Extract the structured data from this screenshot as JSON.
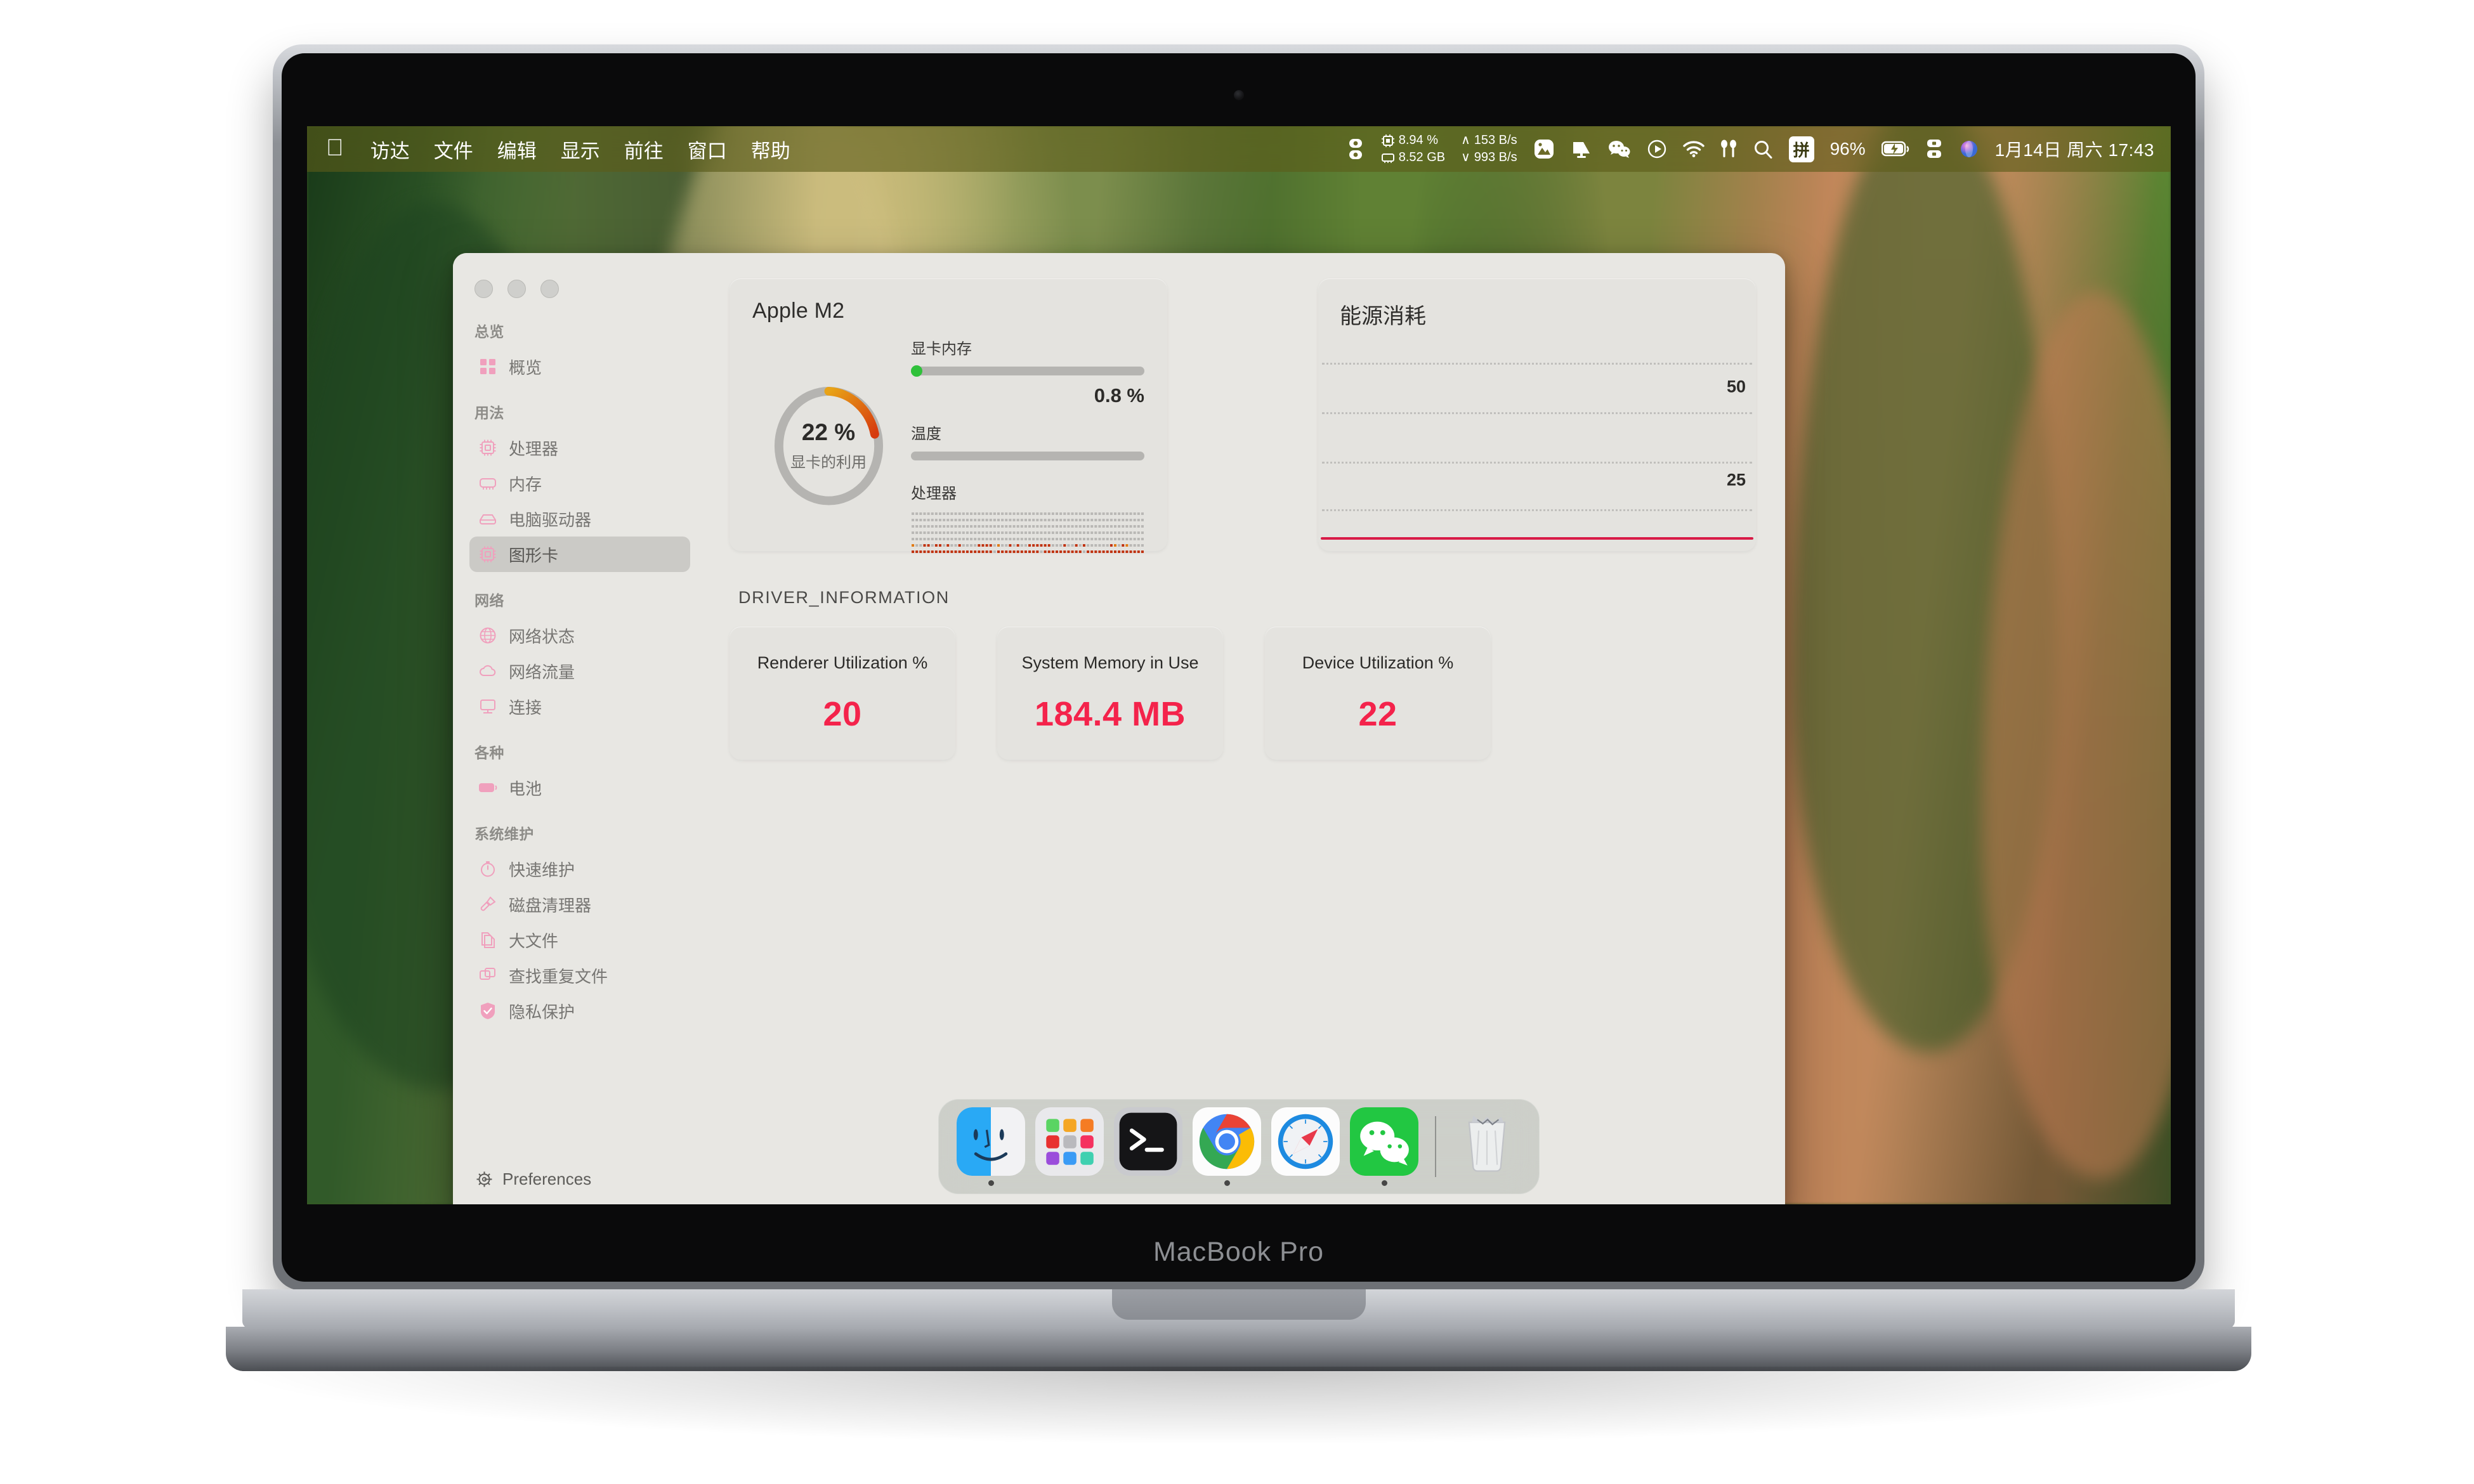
{
  "device": {
    "label": "MacBook Pro"
  },
  "menubar": {
    "apple_icon": "apple-logo",
    "items": [
      "访达",
      "文件",
      "编辑",
      "显示",
      "前往",
      "窗口",
      "帮助"
    ],
    "stats": {
      "cpu_percent": "8.94 %",
      "memory_used": "8.52 GB",
      "net_up": "153 B/s",
      "net_down": "993 B/s",
      "up_arrow": "∧",
      "down_arrow": "∨"
    },
    "icons": [
      "display-toggle-icon",
      "photos-icon",
      "screen-flag-icon",
      "wechat-icon",
      "record-play-icon",
      "wifi-icon",
      "airpods-icon",
      "search-icon"
    ],
    "ime_badge": "拼",
    "battery_percent": "96%",
    "battery_icon": "battery-charging-icon",
    "screen_mirror_icon": "screen-mirror-icon",
    "siri_icon": "siri-icon",
    "datetime": "1月14日 周六  17:43"
  },
  "window": {
    "traffic_lights": [
      "close-button",
      "minimize-button",
      "zoom-button"
    ],
    "sidebar": {
      "groups": [
        {
          "title": "总览",
          "items": [
            {
              "label": "概览",
              "icon": "grid-icon",
              "active": false
            }
          ]
        },
        {
          "title": "用法",
          "items": [
            {
              "label": "处理器",
              "icon": "cpu-chip-icon",
              "active": false
            },
            {
              "label": "内存",
              "icon": "memory-stick-icon",
              "active": false
            },
            {
              "label": "电脑驱动器",
              "icon": "hard-drive-icon",
              "active": false
            },
            {
              "label": "图形卡",
              "icon": "gpu-chip-icon",
              "active": true
            }
          ]
        },
        {
          "title": "网络",
          "items": [
            {
              "label": "网络状态",
              "icon": "globe-icon",
              "active": false
            },
            {
              "label": "网络流量",
              "icon": "cloud-icon",
              "active": false
            },
            {
              "label": "连接",
              "icon": "monitor-icon",
              "active": false
            }
          ]
        },
        {
          "title": "各种",
          "items": [
            {
              "label": "电池",
              "icon": "battery-icon",
              "active": false
            }
          ]
        },
        {
          "title": "系统维护",
          "items": [
            {
              "label": "快速维护",
              "icon": "stopwatch-icon",
              "active": false
            },
            {
              "label": "磁盘清理器",
              "icon": "brush-icon",
              "active": false
            },
            {
              "label": "大文件",
              "icon": "documents-icon",
              "active": false
            },
            {
              "label": "查找重复文件",
              "icon": "duplicate-icon",
              "active": false
            },
            {
              "label": "隐私保护",
              "icon": "shield-check-icon",
              "active": false
            }
          ]
        }
      ],
      "preferences": {
        "label": "Preferences",
        "icon": "gear-icon"
      }
    },
    "gpu_card": {
      "title": "Apple M2",
      "gauge": {
        "value": "22 %",
        "label": "显卡的利用",
        "percent": 22
      },
      "vram": {
        "label": "显卡内存",
        "value": "0.8 %",
        "percent": 0.8
      },
      "temperature": {
        "label": "温度",
        "percent": 0
      },
      "processor": {
        "label": "处理器"
      }
    },
    "energy_card": {
      "title": "能源消耗",
      "y_labels": [
        "50",
        "25"
      ]
    },
    "driver_section": {
      "title": "DRIVER_INFORMATION",
      "tiles": [
        {
          "label": "Renderer Utilization %",
          "value": "20"
        },
        {
          "label": "System Memory in Use",
          "value": "184.4 MB"
        },
        {
          "label": "Device Utilization %",
          "value": "22"
        }
      ]
    }
  },
  "dock": {
    "items": [
      {
        "name": "finder",
        "running": true
      },
      {
        "name": "launchpad",
        "running": false
      },
      {
        "name": "terminal",
        "running": false
      },
      {
        "name": "chrome",
        "running": true
      },
      {
        "name": "safari",
        "running": false
      },
      {
        "name": "wechat",
        "running": true
      }
    ],
    "trash": {
      "name": "trash",
      "running": false
    }
  },
  "colors": {
    "accent_pink": "#f0a0bd",
    "accent_red": "#f4234b",
    "gauge_start": "#e8a317",
    "gauge_end": "#d63a0e",
    "green_dot": "#2fc13a",
    "baseline_red": "#d81b47",
    "window_bg": "#e8e7e3",
    "card_bg": "#e4e3df"
  },
  "chart_data": [
    {
      "type": "line",
      "title": "能源消耗",
      "xlabel": "",
      "ylabel": "",
      "ylim": [
        0,
        62.5
      ],
      "yticks": [
        12.5,
        25,
        37.5,
        50
      ],
      "ytick_labels": [
        "",
        "25",
        "",
        "50"
      ],
      "grid": true,
      "series": [
        {
          "name": "energy",
          "values": [
            0,
            0,
            0,
            0,
            0,
            0,
            0,
            0,
            0,
            0
          ]
        }
      ],
      "x": [
        0,
        1,
        2,
        3,
        4,
        5,
        6,
        7,
        8,
        9
      ],
      "legend": "none",
      "note": "flat baseline at 0 drawn in crimson"
    },
    {
      "type": "bar",
      "title": "显卡的利用",
      "categories": [
        "GPU Utilization"
      ],
      "values": [
        22
      ],
      "ylim": [
        0,
        100
      ],
      "ylabel": "%",
      "note": "radial donut gauge, 22% filled, yellow-to-red gradient"
    },
    {
      "type": "bar",
      "title": "显卡内存",
      "categories": [
        "VRAM"
      ],
      "values": [
        0.8
      ],
      "ylim": [
        0,
        100
      ],
      "ylabel": "%"
    },
    {
      "type": "bar",
      "title": "温度",
      "categories": [
        "Temperature"
      ],
      "values": [
        0
      ],
      "ylim": [
        0,
        100
      ],
      "ylabel": ""
    },
    {
      "type": "heatmap",
      "title": "处理器",
      "xlabel": "",
      "ylabel": "",
      "rows": 7,
      "cols": 60,
      "note": "dot-matrix CPU history; bottom row fully red, second-from-bottom partially red, upper rows idle grey"
    }
  ]
}
